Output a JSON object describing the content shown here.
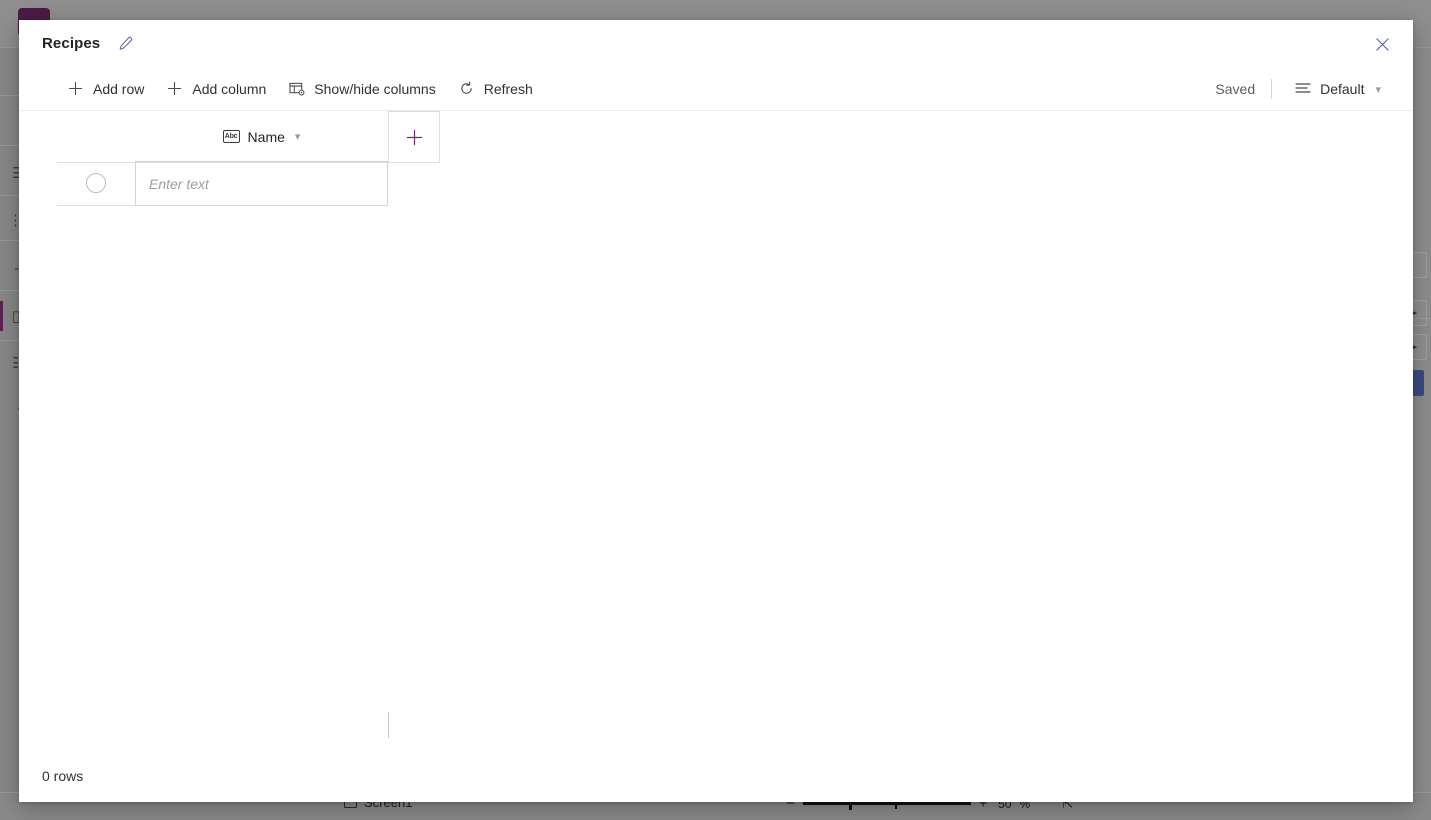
{
  "modal": {
    "title": "Recipes",
    "edit_icon": "pencil-icon",
    "close_icon": "close-icon",
    "commands": [
      {
        "label": "Add row",
        "icon": "plus-icon"
      },
      {
        "label": "Add column",
        "icon": "plus-icon"
      },
      {
        "label": "Show/hide columns",
        "icon": "columns-settings-icon"
      },
      {
        "label": "Refresh",
        "icon": "refresh-icon"
      }
    ],
    "status_label": "Saved",
    "view": {
      "label": "Default",
      "icon": "view-list-icon",
      "caret": "chevron-down-icon"
    },
    "grid": {
      "columns": [
        {
          "label": "Name",
          "type_icon": "abc-text-icon",
          "caret": "chevron-down-icon"
        }
      ],
      "add_column_label": "+",
      "new_row": {
        "placeholder": "Enter text",
        "value": ""
      }
    },
    "footer": {
      "row_count_label": "0 rows"
    }
  },
  "background": {
    "rail_icons": [
      "hamburger-menu-icon",
      "tree-view-icon",
      "insert-icon",
      "data-icon",
      "media-icon",
      "more-icon"
    ],
    "bottom": {
      "screen_label": "Screen1",
      "screen_icon": "screen-rect-icon",
      "zoom_out_icon": "minus-icon",
      "zoom_in_icon": "plus-icon",
      "zoom_value": "50",
      "zoom_unit": "%",
      "fit_icon": "fit-to-screen-icon"
    }
  },
  "colors": {
    "accent_purple": "#742774",
    "brand_dark_purple": "#4b1c46",
    "text_primary": "#242424",
    "text_secondary": "#605e5c",
    "border": "#e1dfdd"
  }
}
